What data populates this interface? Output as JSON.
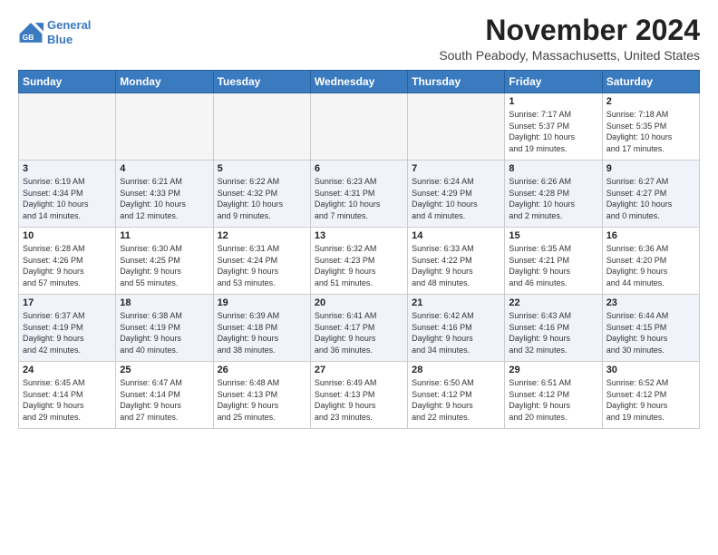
{
  "logo": {
    "line1": "General",
    "line2": "Blue"
  },
  "title": "November 2024",
  "location": "South Peabody, Massachusetts, United States",
  "days_header": [
    "Sunday",
    "Monday",
    "Tuesday",
    "Wednesday",
    "Thursday",
    "Friday",
    "Saturday"
  ],
  "weeks": [
    [
      {
        "day": "",
        "info": ""
      },
      {
        "day": "",
        "info": ""
      },
      {
        "day": "",
        "info": ""
      },
      {
        "day": "",
        "info": ""
      },
      {
        "day": "",
        "info": ""
      },
      {
        "day": "1",
        "info": "Sunrise: 7:17 AM\nSunset: 5:37 PM\nDaylight: 10 hours\nand 19 minutes."
      },
      {
        "day": "2",
        "info": "Sunrise: 7:18 AM\nSunset: 5:35 PM\nDaylight: 10 hours\nand 17 minutes."
      }
    ],
    [
      {
        "day": "3",
        "info": "Sunrise: 6:19 AM\nSunset: 4:34 PM\nDaylight: 10 hours\nand 14 minutes."
      },
      {
        "day": "4",
        "info": "Sunrise: 6:21 AM\nSunset: 4:33 PM\nDaylight: 10 hours\nand 12 minutes."
      },
      {
        "day": "5",
        "info": "Sunrise: 6:22 AM\nSunset: 4:32 PM\nDaylight: 10 hours\nand 9 minutes."
      },
      {
        "day": "6",
        "info": "Sunrise: 6:23 AM\nSunset: 4:31 PM\nDaylight: 10 hours\nand 7 minutes."
      },
      {
        "day": "7",
        "info": "Sunrise: 6:24 AM\nSunset: 4:29 PM\nDaylight: 10 hours\nand 4 minutes."
      },
      {
        "day": "8",
        "info": "Sunrise: 6:26 AM\nSunset: 4:28 PM\nDaylight: 10 hours\nand 2 minutes."
      },
      {
        "day": "9",
        "info": "Sunrise: 6:27 AM\nSunset: 4:27 PM\nDaylight: 10 hours\nand 0 minutes."
      }
    ],
    [
      {
        "day": "10",
        "info": "Sunrise: 6:28 AM\nSunset: 4:26 PM\nDaylight: 9 hours\nand 57 minutes."
      },
      {
        "day": "11",
        "info": "Sunrise: 6:30 AM\nSunset: 4:25 PM\nDaylight: 9 hours\nand 55 minutes."
      },
      {
        "day": "12",
        "info": "Sunrise: 6:31 AM\nSunset: 4:24 PM\nDaylight: 9 hours\nand 53 minutes."
      },
      {
        "day": "13",
        "info": "Sunrise: 6:32 AM\nSunset: 4:23 PM\nDaylight: 9 hours\nand 51 minutes."
      },
      {
        "day": "14",
        "info": "Sunrise: 6:33 AM\nSunset: 4:22 PM\nDaylight: 9 hours\nand 48 minutes."
      },
      {
        "day": "15",
        "info": "Sunrise: 6:35 AM\nSunset: 4:21 PM\nDaylight: 9 hours\nand 46 minutes."
      },
      {
        "day": "16",
        "info": "Sunrise: 6:36 AM\nSunset: 4:20 PM\nDaylight: 9 hours\nand 44 minutes."
      }
    ],
    [
      {
        "day": "17",
        "info": "Sunrise: 6:37 AM\nSunset: 4:19 PM\nDaylight: 9 hours\nand 42 minutes."
      },
      {
        "day": "18",
        "info": "Sunrise: 6:38 AM\nSunset: 4:19 PM\nDaylight: 9 hours\nand 40 minutes."
      },
      {
        "day": "19",
        "info": "Sunrise: 6:39 AM\nSunset: 4:18 PM\nDaylight: 9 hours\nand 38 minutes."
      },
      {
        "day": "20",
        "info": "Sunrise: 6:41 AM\nSunset: 4:17 PM\nDaylight: 9 hours\nand 36 minutes."
      },
      {
        "day": "21",
        "info": "Sunrise: 6:42 AM\nSunset: 4:16 PM\nDaylight: 9 hours\nand 34 minutes."
      },
      {
        "day": "22",
        "info": "Sunrise: 6:43 AM\nSunset: 4:16 PM\nDaylight: 9 hours\nand 32 minutes."
      },
      {
        "day": "23",
        "info": "Sunrise: 6:44 AM\nSunset: 4:15 PM\nDaylight: 9 hours\nand 30 minutes."
      }
    ],
    [
      {
        "day": "24",
        "info": "Sunrise: 6:45 AM\nSunset: 4:14 PM\nDaylight: 9 hours\nand 29 minutes."
      },
      {
        "day": "25",
        "info": "Sunrise: 6:47 AM\nSunset: 4:14 PM\nDaylight: 9 hours\nand 27 minutes."
      },
      {
        "day": "26",
        "info": "Sunrise: 6:48 AM\nSunset: 4:13 PM\nDaylight: 9 hours\nand 25 minutes."
      },
      {
        "day": "27",
        "info": "Sunrise: 6:49 AM\nSunset: 4:13 PM\nDaylight: 9 hours\nand 23 minutes."
      },
      {
        "day": "28",
        "info": "Sunrise: 6:50 AM\nSunset: 4:12 PM\nDaylight: 9 hours\nand 22 minutes."
      },
      {
        "day": "29",
        "info": "Sunrise: 6:51 AM\nSunset: 4:12 PM\nDaylight: 9 hours\nand 20 minutes."
      },
      {
        "day": "30",
        "info": "Sunrise: 6:52 AM\nSunset: 4:12 PM\nDaylight: 9 hours\nand 19 minutes."
      }
    ]
  ]
}
